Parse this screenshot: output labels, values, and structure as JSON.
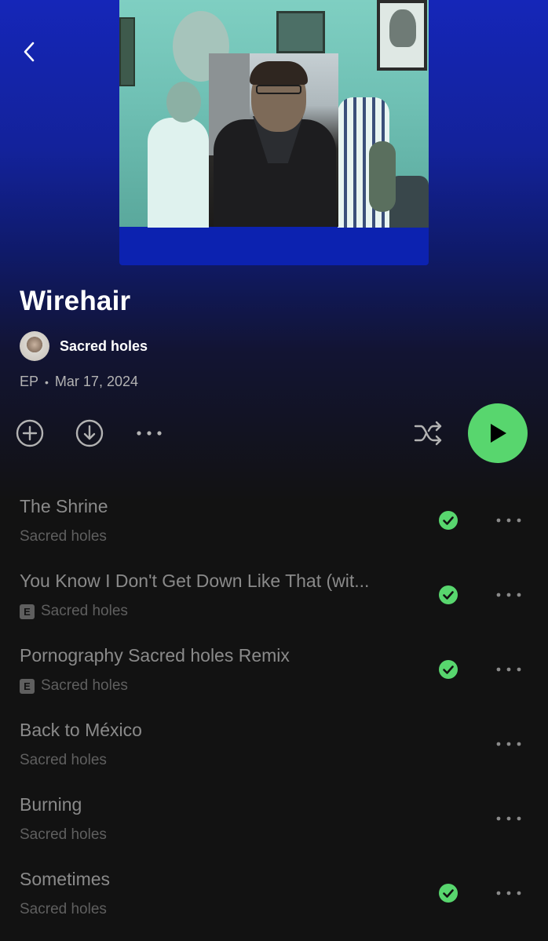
{
  "colors": {
    "accent": "#58d66e",
    "header_gradient_top": "#1526b8",
    "background": "#121212",
    "muted_text": "#8a8a8a"
  },
  "icons": {
    "back": "chevron-left-icon",
    "add": "plus-circle-icon",
    "download": "download-circle-icon",
    "more": "more-horizontal-icon",
    "shuffle": "shuffle-icon",
    "play": "play-icon",
    "downloaded": "check-circle-icon",
    "explicit": "explicit-badge"
  },
  "album": {
    "title": "Wirehair",
    "artist": "Sacred holes",
    "type": "EP",
    "separator": "•",
    "date": "Mar 17, 2024"
  },
  "explicit_label": "E",
  "tracks": [
    {
      "title": "The Shrine",
      "artist": "Sacred holes",
      "explicit": false,
      "downloaded": true
    },
    {
      "title": "You Know I Don't Get Down Like That (wit...",
      "artist": "Sacred holes",
      "explicit": true,
      "downloaded": true
    },
    {
      "title": "Pornography Sacred holes Remix",
      "artist": "Sacred holes",
      "explicit": true,
      "downloaded": true
    },
    {
      "title": "Back to México",
      "artist": "Sacred holes",
      "explicit": false,
      "downloaded": false
    },
    {
      "title": "Burning",
      "artist": "Sacred holes",
      "explicit": false,
      "downloaded": false
    },
    {
      "title": "Sometimes",
      "artist": "Sacred holes",
      "explicit": false,
      "downloaded": true
    }
  ]
}
